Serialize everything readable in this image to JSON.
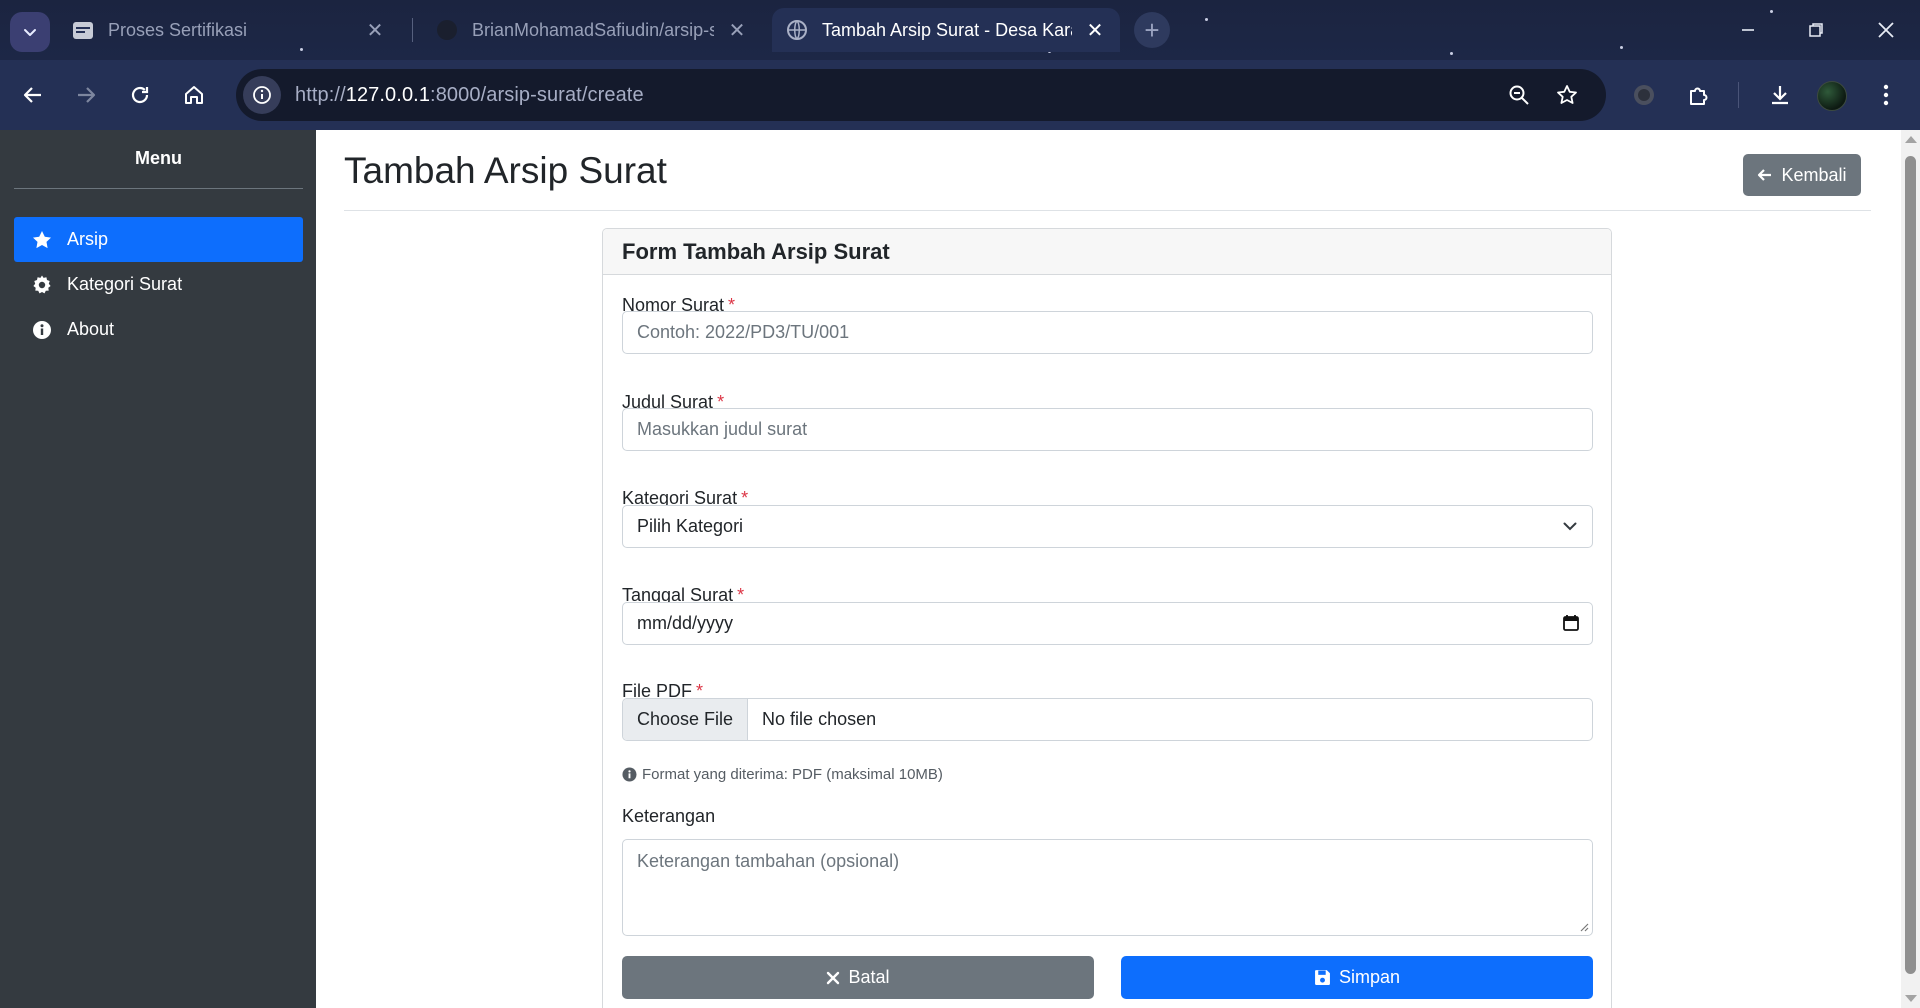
{
  "browser": {
    "tabs": [
      {
        "title": "Proses Sertifikasi",
        "active": false,
        "icon": "calendar-favicon"
      },
      {
        "title": "BrianMohamadSafiudin/arsip-s",
        "active": false,
        "icon": "github-favicon"
      },
      {
        "title": "Tambah Arsip Surat - Desa Kara",
        "active": true,
        "icon": "globe-favicon"
      }
    ],
    "url_scheme": "http://",
    "url_host": "127.0.0.1",
    "url_path": ":8000/arsip-surat/create"
  },
  "sidebar": {
    "title": "Menu",
    "items": [
      {
        "label": "Arsip",
        "icon": "star-icon",
        "active": true
      },
      {
        "label": "Kategori Surat",
        "icon": "gear-icon",
        "active": false
      },
      {
        "label": "About",
        "icon": "info-icon",
        "active": false
      }
    ]
  },
  "header": {
    "title": "Tambah Arsip Surat",
    "back_label": "Kembali"
  },
  "form": {
    "card_title": "Form Tambah Arsip Surat",
    "nomor": {
      "label": "Nomor Surat",
      "required": "*",
      "placeholder": "Contoh: 2022/PD3/TU/001"
    },
    "judul": {
      "label": "Judul Surat",
      "required": "*",
      "placeholder": "Masukkan judul surat"
    },
    "kategori": {
      "label": "Kategori Surat",
      "required": "*",
      "value": "Pilih Kategori"
    },
    "tanggal": {
      "label": "Tanggal Surat",
      "required": "*",
      "value": "mm/dd/yyyy"
    },
    "file": {
      "label": "File PDF",
      "required": "*",
      "button": "Choose File",
      "status": "No file chosen",
      "help": "Format yang diterima: PDF (maksimal 10MB)"
    },
    "keterangan": {
      "label": "Keterangan",
      "placeholder": "Keterangan tambahan (opsional)"
    },
    "cancel_label": "Batal",
    "save_label": "Simpan"
  },
  "colors": {
    "primary": "#0d6efd",
    "secondary": "#6c757d",
    "sidebar_bg": "#343a40",
    "required": "#dc3545"
  }
}
